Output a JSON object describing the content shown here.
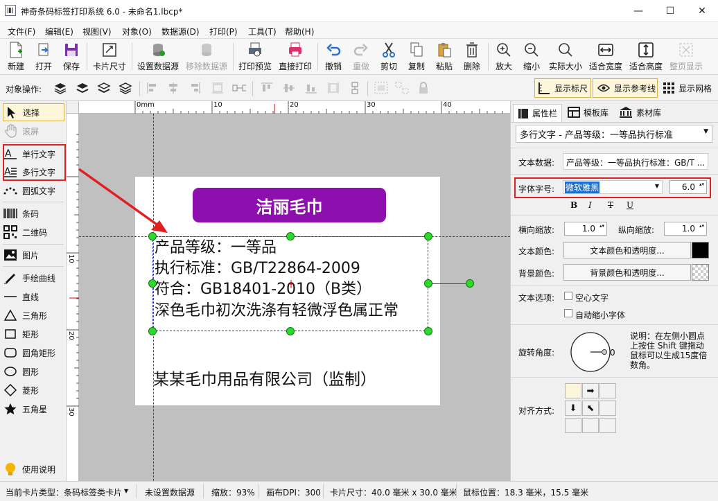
{
  "window": {
    "title": "神奇条码标签打印系统 6.0 - 未命名1.lbcp*"
  },
  "menu": [
    "文件(F)",
    "编辑(E)",
    "视图(V)",
    "对象(O)",
    "数据源(D)",
    "打印(P)",
    "工具(T)",
    "帮助(H)"
  ],
  "toolbar": {
    "new": "新建",
    "open": "打开",
    "save": "保存",
    "card_size": "卡片尺寸",
    "set_datasource": "设置数据源",
    "remove_datasource": "移除数据源",
    "print_preview": "打印预览",
    "direct_print": "直接打印",
    "undo": "撤销",
    "redo": "重做",
    "cut": "剪切",
    "copy": "复制",
    "paste": "粘贴",
    "delete": "删除",
    "zoom_in": "放大",
    "zoom_out": "缩小",
    "actual_size": "实际大小",
    "fit_width": "适合宽度",
    "fit_height": "适合高度",
    "full_page": "整页显示"
  },
  "objbar": {
    "label": "对象操作:",
    "show_ruler": "显示标尺",
    "show_guides": "显示参考线",
    "show_grid": "显示网格"
  },
  "tools": {
    "select": "选择",
    "scroll": "滚屏",
    "single_text": "单行文字",
    "multi_text": "多行文字",
    "arc_text": "圆弧文字",
    "barcode": "条码",
    "qrcode": "二维码",
    "image": "图片",
    "freehand": "手绘曲线",
    "line": "直线",
    "triangle": "三角形",
    "rect": "矩形",
    "round_rect": "圆角矩形",
    "ellipse": "圆形",
    "diamond": "菱形",
    "star": "五角星",
    "help": "使用说明"
  },
  "ruler": {
    "h": [
      "0mm",
      "10",
      "20",
      "30",
      "40"
    ],
    "v": [
      "10",
      "20",
      "30"
    ]
  },
  "card": {
    "brand": "洁丽毛巾",
    "lines": [
      "产品等级：一等品",
      "执行标准：GB/T22864-2009",
      "符合：GB18401-2010（B类）",
      "深色毛巾初次洗涤有轻微浮色属正常"
    ],
    "footer": "某某毛巾用品有限公司（监制）"
  },
  "panel": {
    "tabs": [
      "属性栏",
      "模板库",
      "素材库"
    ],
    "object_select": "多行文字 - 产品等级：一等品执行标准",
    "text_data_label": "文本数据:",
    "text_data_value": "产品等级：一等品执行标准：GB/T ...",
    "font_label": "字体字号:",
    "font_name": "微软雅黑",
    "font_size": "6.0",
    "style_buttons": [
      "B",
      "I",
      "T",
      "U"
    ],
    "hscale_label": "横向缩放:",
    "hscale": "1.0",
    "vscale_label": "纵向缩放:",
    "vscale": "1.0",
    "text_color_label": "文本颜色:",
    "text_color_button": "文本颜色和透明度...",
    "bg_color_label": "背景颜色:",
    "bg_color_button": "背景颜色和透明度...",
    "text_opts_label": "文本选项:",
    "hollow_text": "空心文字",
    "auto_shrink": "自动缩小字体",
    "rotation_label": "旋转角度:",
    "rotation_value": "0",
    "rotation_note": "说明：在左侧小圆点上按住 Shift 键拖动鼠标可以生成15度倍数角。",
    "align_label": "对齐方式:"
  },
  "status": {
    "card_type": "当前卡片类型：条码标签类卡片",
    "datasource": "未设置数据源",
    "zoom": "缩放：93%",
    "dpi": "画布DPI：300",
    "card_size": "卡片尺寸：40.0 毫米 x 30.0 毫米",
    "mouse": "鼠标位置：18.3 毫米，15.5 毫米"
  },
  "colors": {
    "brand_bg": "#8c0fae",
    "handle": "#2ed82e",
    "highlight": "#e02020",
    "guide": "#3333dd"
  }
}
